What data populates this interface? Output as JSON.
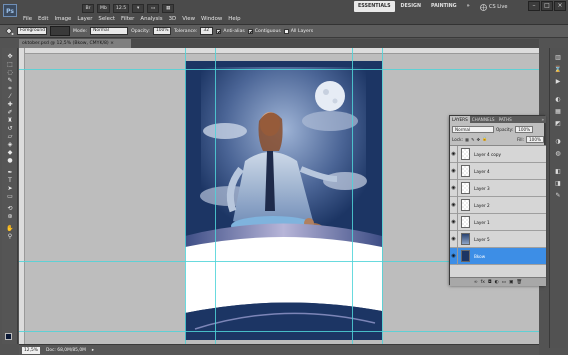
{
  "app": {
    "logo": "Ps",
    "menus": [
      "File",
      "Edit",
      "Image",
      "Layer",
      "Select",
      "Filter",
      "Analysis",
      "3D",
      "View",
      "Window",
      "Help"
    ],
    "app_bar": [
      "Br",
      "Mb",
      "12.5",
      "▾",
      "▭",
      "▦"
    ],
    "workspaces": [
      "ESSENTIALS",
      "DESIGN",
      "PAINTING",
      "»"
    ],
    "cs_live": "CS Live",
    "window_controls": [
      "–",
      "□",
      "×"
    ]
  },
  "options": {
    "tool_preset": "Foreground",
    "mode_label": "Mode:",
    "mode_value": "Normal",
    "opacity_label": "Opacity:",
    "opacity_value": "100%",
    "tolerance_label": "Tolerance:",
    "tolerance_value": "32",
    "antialias_label": "Anti-alias",
    "antialias_checked": true,
    "contiguous_label": "Contiguous",
    "contiguous_checked": true,
    "all_layers_label": "All Layers",
    "all_layers_checked": false
  },
  "document": {
    "tab_title": "oktober.psd @ 12,5% (Bkow, CMYK/8) ×"
  },
  "status": {
    "zoom": "12,5%",
    "doc_size": "Doc: 68,0M/85,0M"
  },
  "layers_panel": {
    "tabs": [
      "LAYERS",
      "CHANNELS",
      "PATHS"
    ],
    "menu": "»",
    "blend_mode": "Normal",
    "opacity_label": "Opacity:",
    "opacity_value": "100%",
    "lock_label": "Lock:",
    "fill_label": "Fill:",
    "fill_value": "100%",
    "layers": [
      {
        "name": "Layer 4 copy",
        "thumb": "transparent",
        "selected": false
      },
      {
        "name": "Layer 4",
        "thumb": "transparent",
        "selected": false
      },
      {
        "name": "Layer 3",
        "thumb": "transparent",
        "selected": false
      },
      {
        "name": "Layer 2",
        "thumb": "transparent",
        "selected": false
      },
      {
        "name": "Layer 1",
        "thumb": "transparent",
        "selected": false
      },
      {
        "name": "Layer 5",
        "thumb": "photo",
        "selected": false
      },
      {
        "name": "Bkow",
        "thumb": "navy",
        "selected": true
      }
    ],
    "footer": [
      "∞",
      "fx",
      "◘",
      "◐",
      "▭",
      "▣",
      "🗑"
    ]
  },
  "colors": {
    "foreground": "#0a1835",
    "background": "#ffffff",
    "guide": "#4fd3d8",
    "selected_layer": "#3d8ee6",
    "doc_navy": "#1c3564"
  }
}
